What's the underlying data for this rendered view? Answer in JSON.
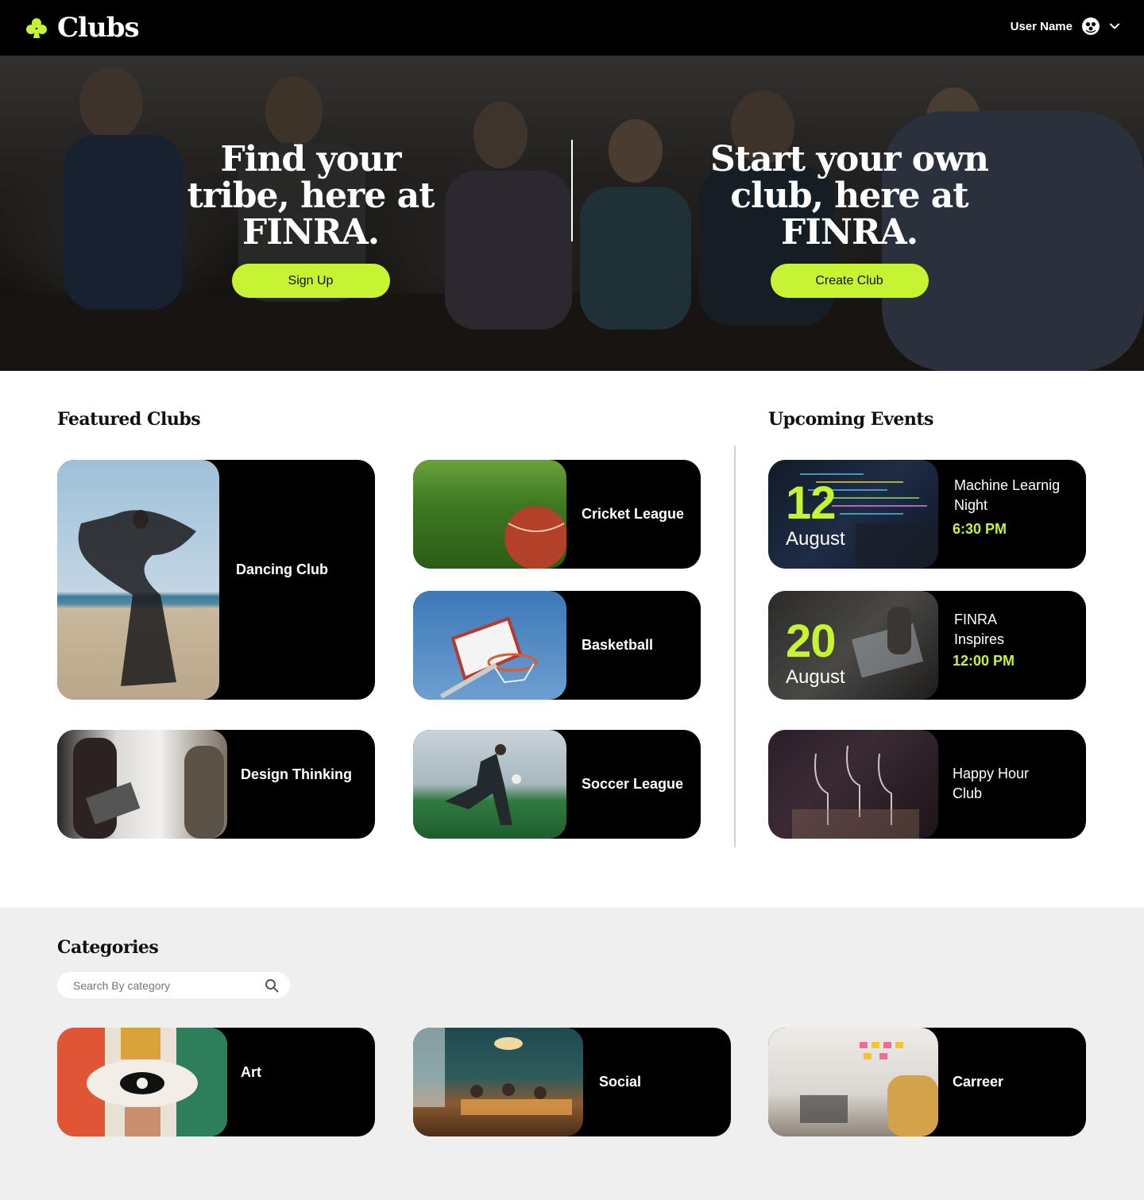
{
  "nav": {
    "brand": "Clubs",
    "user_name": "User Name",
    "accent": "#c6f432"
  },
  "hero": {
    "left_title": "Find your tribe, here at FINRA.",
    "left_button": "Sign Up",
    "right_title": "Start your own club, here at FINRA.",
    "right_button": "Create Club"
  },
  "featured": {
    "title": "Featured Clubs",
    "items": [
      {
        "name": "Dancing Club"
      },
      {
        "name": "Cricket League"
      },
      {
        "name": "Basketball"
      },
      {
        "name": "Design Thinking"
      },
      {
        "name": "Soccer League"
      }
    ]
  },
  "events": {
    "title": "Upcoming Events",
    "items": [
      {
        "day": "12",
        "month": "August",
        "name": "Machine Learnig Night",
        "time": "6:30 PM"
      },
      {
        "day": "20",
        "month": "August",
        "name": "FINRA Inspires",
        "time": "12:00 PM"
      },
      {
        "name": "Happy Hour Club"
      }
    ]
  },
  "categories": {
    "title": "Categories",
    "search_placeholder": "Search By category",
    "items": [
      {
        "name": "Art"
      },
      {
        "name": "Social"
      },
      {
        "name": "Carreer"
      }
    ]
  }
}
